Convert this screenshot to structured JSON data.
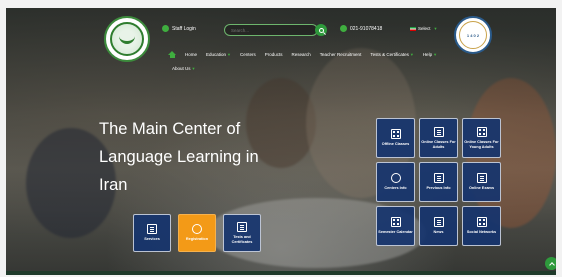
{
  "header": {
    "staff_login": "Staff Login",
    "search_placeholder": "Search...",
    "phone": "021-91078418",
    "language": "Select",
    "badge_text": "1 4 0 2"
  },
  "nav": {
    "items": [
      "Home",
      "Education",
      "Centers",
      "Products",
      "Research",
      "Teacher Recruitment",
      "Tests & Certificates",
      "Help"
    ],
    "second_row": "About Us"
  },
  "hero": {
    "line1": "The Main Center of",
    "line2": "Language Learning in",
    "line3": "Iran"
  },
  "left_tiles": [
    {
      "label": "Services",
      "icon": "services-icon",
      "color": "#16346e"
    },
    {
      "label": "Registration",
      "icon": "registration-icon",
      "color": "#f39a17"
    },
    {
      "label": "Tests and Certificates",
      "icon": "certificates-icon",
      "color": "#16346e"
    }
  ],
  "right_tiles": [
    {
      "label": "Offline Classes",
      "icon": "classroom-icon"
    },
    {
      "label": "Online Classes For Adults",
      "icon": "laptop-icon"
    },
    {
      "label": "Online Classes For Young Adults",
      "icon": "group-icon"
    },
    {
      "label": "Centers Info",
      "icon": "location-icon"
    },
    {
      "label": "Previous Info",
      "icon": "history-icon"
    },
    {
      "label": "Online Exams",
      "icon": "exam-icon"
    },
    {
      "label": "Semester Calendar",
      "icon": "calendar-icon"
    },
    {
      "label": "News",
      "icon": "news-icon"
    },
    {
      "label": "Social Networks",
      "icon": "social-icon"
    }
  ],
  "colors": {
    "accent_green": "#2e9a3c",
    "tile_blue": "#16346e",
    "tile_orange": "#f39a17"
  }
}
